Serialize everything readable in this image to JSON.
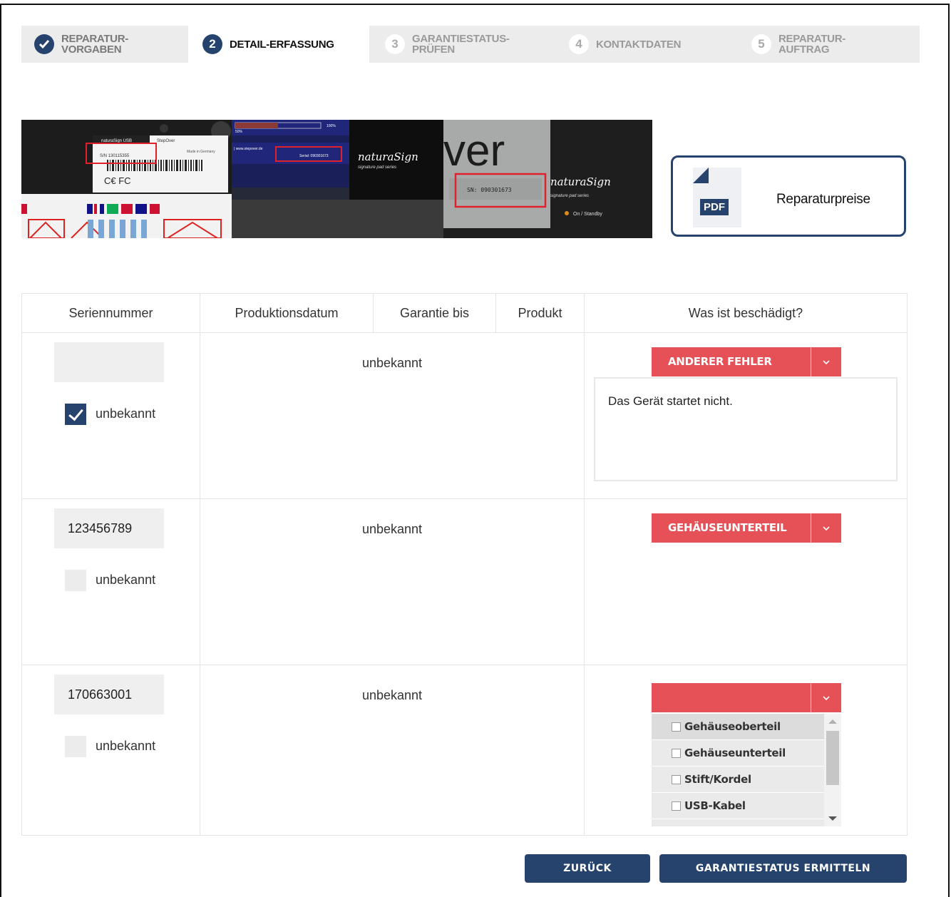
{
  "steps": [
    {
      "num": "",
      "label": "Reparatur-\nVorgaben",
      "state": "done"
    },
    {
      "num": "2",
      "label": "Detail-Erfassung",
      "state": "active"
    },
    {
      "num": "3",
      "label": "Garantiestatus-\nprüfen",
      "state": "todo"
    },
    {
      "num": "4",
      "label": "Kontaktdaten",
      "state": "todo"
    },
    {
      "num": "5",
      "label": "Reparatur-\nAuftrag",
      "state": "todo"
    }
  ],
  "hero": {
    "label1_sn": "S/N 130115355",
    "label1_brand": "naturaSign USB",
    "label1_maker": "StepOver",
    "label1_germany": "Made in Germany",
    "label2_serial": "Serial: 090301673",
    "label2_pct": "100%",
    "label2_half": "50%",
    "brand_script": "naturaSign",
    "brand_sub": "signature pad series",
    "big_text": "ver",
    "sn_plate": "SN: 090301673",
    "standby": "On / Standby"
  },
  "pdf": {
    "badge": "PDF",
    "title": "Reparaturpreise"
  },
  "table": {
    "headers": [
      "Seriennummer",
      "Produktionsdatum",
      "Garantie bis",
      "Produkt",
      "Was ist beschädigt?"
    ],
    "rows": [
      {
        "serial": "",
        "unknown_checked": true,
        "unknown_label": "unbekannt",
        "status": "unbekannt",
        "damage": "Anderer Fehler",
        "description": "Das Gerät startet nicht."
      },
      {
        "serial": "123456789",
        "unknown_checked": false,
        "unknown_label": "unbekannt",
        "status": "unbekannt",
        "damage": "Gehäuseunterteil"
      },
      {
        "serial": "170663001",
        "unknown_checked": false,
        "unknown_label": "unbekannt",
        "status": "unbekannt",
        "damage": "",
        "options": [
          "Gehäuseoberteil",
          "Gehäuseunterteil",
          "Stift/Kordel",
          "USB-Kabel"
        ]
      }
    ]
  },
  "buttons": {
    "back": "Zurück",
    "next": "Garantiestatus ermitteln"
  },
  "colors": {
    "primary": "#26436e",
    "accent": "#e55157",
    "step_bg": "#ececec"
  }
}
